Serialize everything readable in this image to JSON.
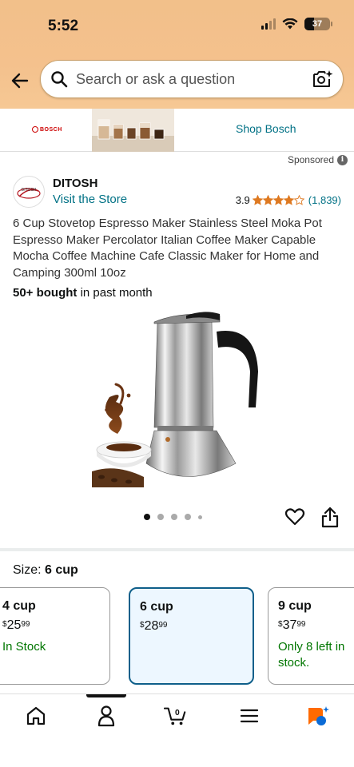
{
  "status_bar": {
    "time": "5:52",
    "battery": "37"
  },
  "search": {
    "placeholder": "Search or ask a question"
  },
  "banner": {
    "brand_logo_text": "BOSCH",
    "link": "Shop Bosch"
  },
  "sponsored": {
    "label": "Sponsored"
  },
  "brand": {
    "name": "DITOSH",
    "logo_text": "DITOSH",
    "visit_store": "Visit the Store"
  },
  "rating": {
    "value": "3.9",
    "stars": 3.9,
    "count": "(1,839)"
  },
  "product": {
    "title": "6 Cup Stovetop Espresso Maker Stainless Steel Moka Pot Espresso Maker Percolator Italian Coffee Maker Capable Mocha Coffee Machine Cafe Classic Maker for Home and Camping 300ml 10oz",
    "bought_bold": "50+ bought",
    "bought_rest": " in past month"
  },
  "carousel": {
    "total": 5,
    "active": 0
  },
  "size": {
    "label": "Size: ",
    "selected": "6 cup",
    "options": [
      {
        "size": "4 cup",
        "symbol": "$",
        "whole": "25",
        "cents": "99",
        "availability": "In Stock"
      },
      {
        "size": "6 cup",
        "symbol": "$",
        "whole": "28",
        "cents": "99",
        "availability": ""
      },
      {
        "size": "9 cup",
        "symbol": "$",
        "whole": "37",
        "cents": "99",
        "availability": "Only 8 left in stock."
      }
    ]
  },
  "nav": {
    "cart_count": "0"
  },
  "colors": {
    "header": "#f4c18d",
    "link": "#007185",
    "star": "#de7921",
    "in_stock": "#007600",
    "selected_border": "#0f5f8a"
  }
}
